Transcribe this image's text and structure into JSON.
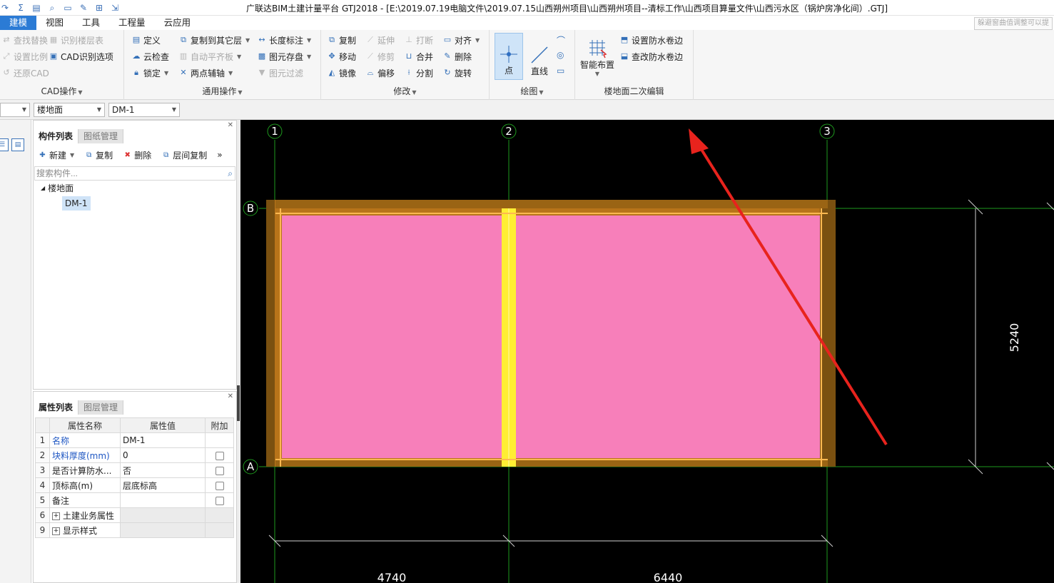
{
  "window": {
    "title": "广联达BIM土建计量平台 GTJ2018 - [E:\\2019.07.19电脑文件\\2019.07.15山西朔州项目\\山西朔州项目--清标工作\\山西项目算量文件\\山西污水区（锅炉房净化间）.GTJ]",
    "hint": "躲避窗曲值调整可以提"
  },
  "menu": {
    "items": [
      {
        "label": "建模",
        "active": true
      },
      {
        "label": "视图",
        "active": false
      },
      {
        "label": "工具",
        "active": false
      },
      {
        "label": "工程量",
        "active": false
      },
      {
        "label": "云应用",
        "active": false
      }
    ]
  },
  "ribbon": {
    "cad_group": {
      "label": "CAD操作",
      "find_replace": "查找替换",
      "identify_floor": "识别楼层表",
      "set_scale": "设置比例",
      "cad_options": "CAD识别选项",
      "restore_cad": "还原CAD"
    },
    "common_group": {
      "label": "通用操作",
      "define": "定义",
      "copy_to_floor": "复制到其它层",
      "length_dim": "长度标注",
      "cloud_check": "云检查",
      "auto_align": "自动平齐板",
      "element_save": "图元存盘",
      "lock": "锁定",
      "two_point_axis": "两点辅轴",
      "element_filter": "图元过滤"
    },
    "modify_group": {
      "label": "修改",
      "copy": "复制",
      "extend": "延伸",
      "break": "打断",
      "align": "对齐",
      "move": "移动",
      "trim": "修剪",
      "merge": "合并",
      "delete": "删除",
      "mirror": "镜像",
      "offset": "偏移",
      "split": "分割",
      "rotate": "旋转"
    },
    "draw_group": {
      "label": "绘图",
      "point": "点",
      "line": "直线"
    },
    "floor_edit_group": {
      "label": "楼地面二次编辑",
      "smart_layout": "智能布置",
      "set_waterproof": "设置防水卷边",
      "check_waterproof": "查改防水卷边"
    }
  },
  "selectors": {
    "type": "楼地面",
    "component": "DM-1"
  },
  "component_panel": {
    "tab_active": "构件列表",
    "tab_other": "图纸管理",
    "new": "新建",
    "copy": "复制",
    "delete": "删除",
    "floor_copy": "层间复制",
    "search_placeholder": "搜索构件...",
    "tree_root": "楼地面",
    "tree_child": "DM-1"
  },
  "property_panel": {
    "tab_active": "属性列表",
    "tab_other": "图层管理",
    "headers": {
      "name": "属性名称",
      "value": "属性值",
      "extra": "附加"
    },
    "rows": [
      {
        "idx": "1",
        "name": "名称",
        "value": "DM-1",
        "blue": true,
        "check": false,
        "group": false
      },
      {
        "idx": "2",
        "name": "块料厚度(mm)",
        "value": "0",
        "blue": true,
        "check": true,
        "group": false
      },
      {
        "idx": "3",
        "name": "是否计算防水...",
        "value": "否",
        "blue": false,
        "check": true,
        "group": false
      },
      {
        "idx": "4",
        "name": "顶标高(m)",
        "value": "层底标高",
        "blue": false,
        "check": true,
        "group": false
      },
      {
        "idx": "5",
        "name": "备注",
        "value": "",
        "blue": false,
        "check": true,
        "group": false
      },
      {
        "idx": "6",
        "name": "土建业务属性",
        "value": "",
        "blue": false,
        "check": false,
        "group": true
      },
      {
        "idx": "9",
        "name": "显示样式",
        "value": "",
        "blue": false,
        "check": false,
        "group": true
      }
    ]
  },
  "drawing": {
    "axes_x": [
      "1",
      "2",
      "3"
    ],
    "axes_y": [
      "B",
      "A"
    ],
    "dim_vertical": "5240",
    "dim_bottom": [
      "4740",
      "6440"
    ],
    "colors": {
      "background": "#000000",
      "floor_fill": "#f77fba",
      "wall": "#b8741a",
      "wall_dark": "#7a5010",
      "yellow_beam": "#ffee33",
      "grid_line": "#1e9a1e",
      "annotation_arrow": "#e8231d"
    }
  }
}
